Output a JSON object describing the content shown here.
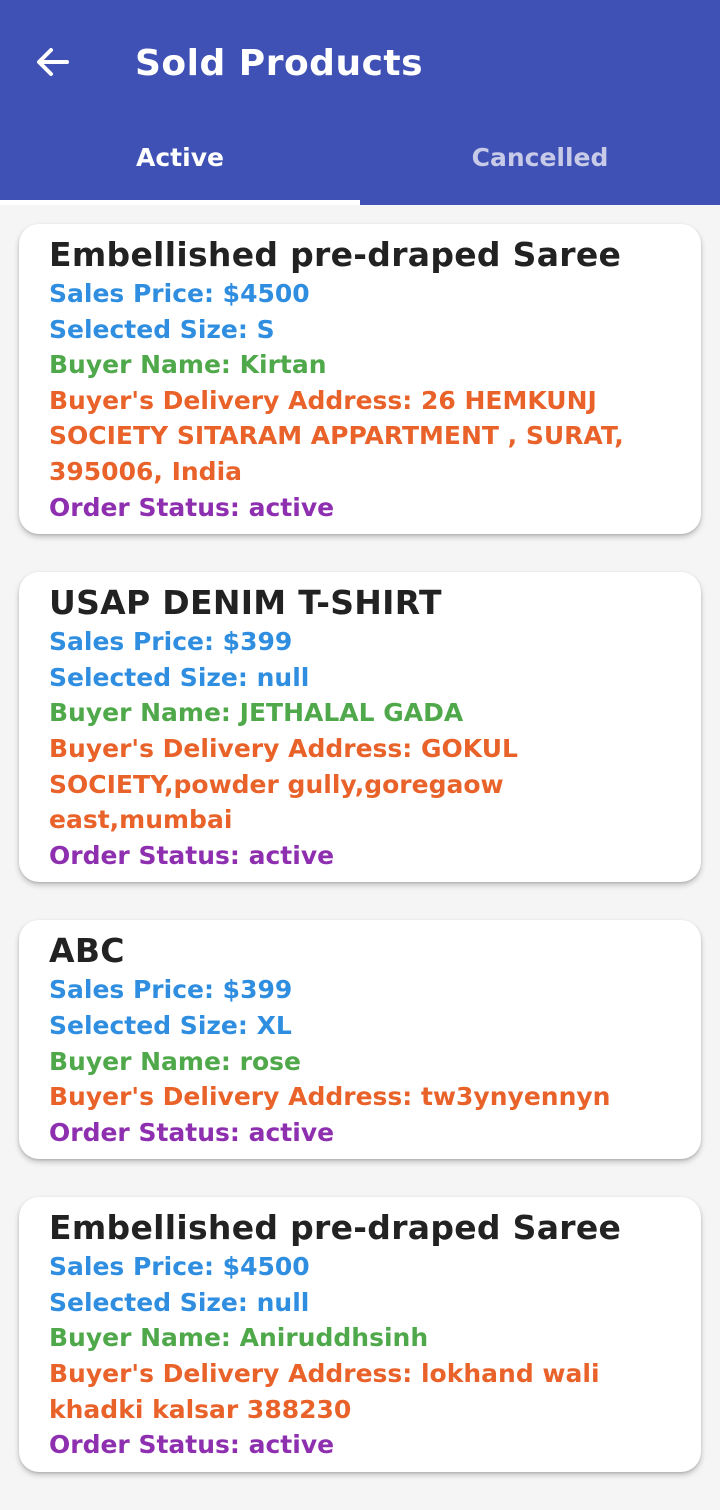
{
  "header": {
    "title": "Sold Products",
    "back_icon": "arrow-left-icon",
    "background": "#3f51b5"
  },
  "tabs": [
    {
      "label": "Active",
      "selected": true
    },
    {
      "label": "Cancelled",
      "selected": false
    }
  ],
  "colors": {
    "price": "#2f8ee0",
    "buyer": "#4fa84a",
    "address": "#e8622a",
    "status": "#8e2fb0"
  },
  "orders": [
    {
      "name": "Embellished pre-draped Saree",
      "price": "Sales Price: $4500",
      "size": "Selected Size: S",
      "buyer": "Buyer Name: Kirtan",
      "address": "Buyer's Delivery Address: 26 HEMKUNJ SOCIETY SITARAM APPARTMENT , SURAT, 395006, India",
      "status": "Order Status: active"
    },
    {
      "name": "USAP DENIM T-SHIRT",
      "price": "Sales Price: $399",
      "size": "Selected Size: null",
      "buyer": "Buyer Name: JETHALAL GADA",
      "address": "Buyer's Delivery Address: GOKUL SOCIETY,powder gully,goregaow east,mumbai",
      "status": "Order Status: active"
    },
    {
      "name": "ABC",
      "price": "Sales Price: $399",
      "size": "Selected Size: XL",
      "buyer": "Buyer Name: rose",
      "address": "Buyer's Delivery Address:  tw3ynyennyn",
      "status": "Order Status: active"
    },
    {
      "name": "Embellished pre-draped Saree",
      "price": "Sales Price: $4500",
      "size": "Selected Size: null",
      "buyer": "Buyer Name: Aniruddhsinh",
      "address": "Buyer's Delivery Address: lokhand wali khadki kalsar 388230",
      "status": "Order Status: active"
    }
  ]
}
